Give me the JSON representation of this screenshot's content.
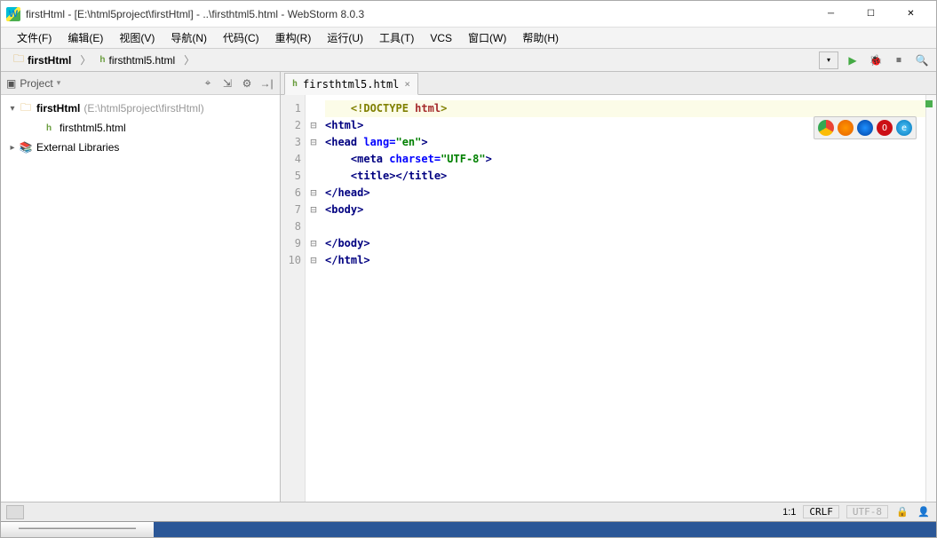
{
  "window": {
    "title": "firstHtml - [E:\\html5project\\firstHtml] - ..\\firsthtml5.html - WebStorm 8.0.3"
  },
  "menu": {
    "file": "文件(F)",
    "edit": "编辑(E)",
    "view": "视图(V)",
    "navigate": "导航(N)",
    "code": "代码(C)",
    "refactor": "重构(R)",
    "run": "运行(U)",
    "tools": "工具(T)",
    "vcs": "VCS",
    "window": "窗口(W)",
    "help": "帮助(H)"
  },
  "breadcrumb": {
    "root": "firstHtml",
    "file": "firsthtml5.html"
  },
  "sidebar": {
    "title": "Project",
    "project_name": "firstHtml",
    "project_path": "(E:\\html5project\\firstHtml)",
    "file": "firsthtml5.html",
    "external": "External Libraries"
  },
  "tab": {
    "label": "firsthtml5.html"
  },
  "code": {
    "lines": [
      {
        "n": "1",
        "fold": "",
        "html": "    <span class='doctype'>&lt;!DOCTYPE </span><span class='doctype-html'>html</span><span class='doctype'>&gt;</span>",
        "hl": true
      },
      {
        "n": "2",
        "fold": "⊟",
        "html": "<span class='tag-b'>&lt;html&gt;</span>"
      },
      {
        "n": "3",
        "fold": "⊟",
        "html": "<span class='tag-b'>&lt;head </span><span class='attr'>lang=</span><span class='str'>\"en\"</span><span class='tag-b'>&gt;</span>"
      },
      {
        "n": "4",
        "fold": "",
        "html": "    <span class='tag-b'>&lt;meta </span><span class='attr'>charset=</span><span class='str'>\"UTF-8\"</span><span class='tag-b'>&gt;</span>"
      },
      {
        "n": "5",
        "fold": "",
        "html": "    <span class='tag-b'>&lt;title&gt;&lt;/title&gt;</span>"
      },
      {
        "n": "6",
        "fold": "⊟",
        "html": "<span class='tag-b'>&lt;/head&gt;</span>"
      },
      {
        "n": "7",
        "fold": "⊟",
        "html": "<span class='tag-b'>&lt;body&gt;</span>"
      },
      {
        "n": "8",
        "fold": "",
        "html": ""
      },
      {
        "n": "9",
        "fold": "⊟",
        "html": "<span class='tag-b'>&lt;/body&gt;</span>"
      },
      {
        "n": "10",
        "fold": "⊟",
        "html": "<span class='tag-b'>&lt;/html&gt;</span>"
      }
    ]
  },
  "status": {
    "pos": "1:1",
    "eol": "CRLF",
    "enc": "UTF-8"
  }
}
